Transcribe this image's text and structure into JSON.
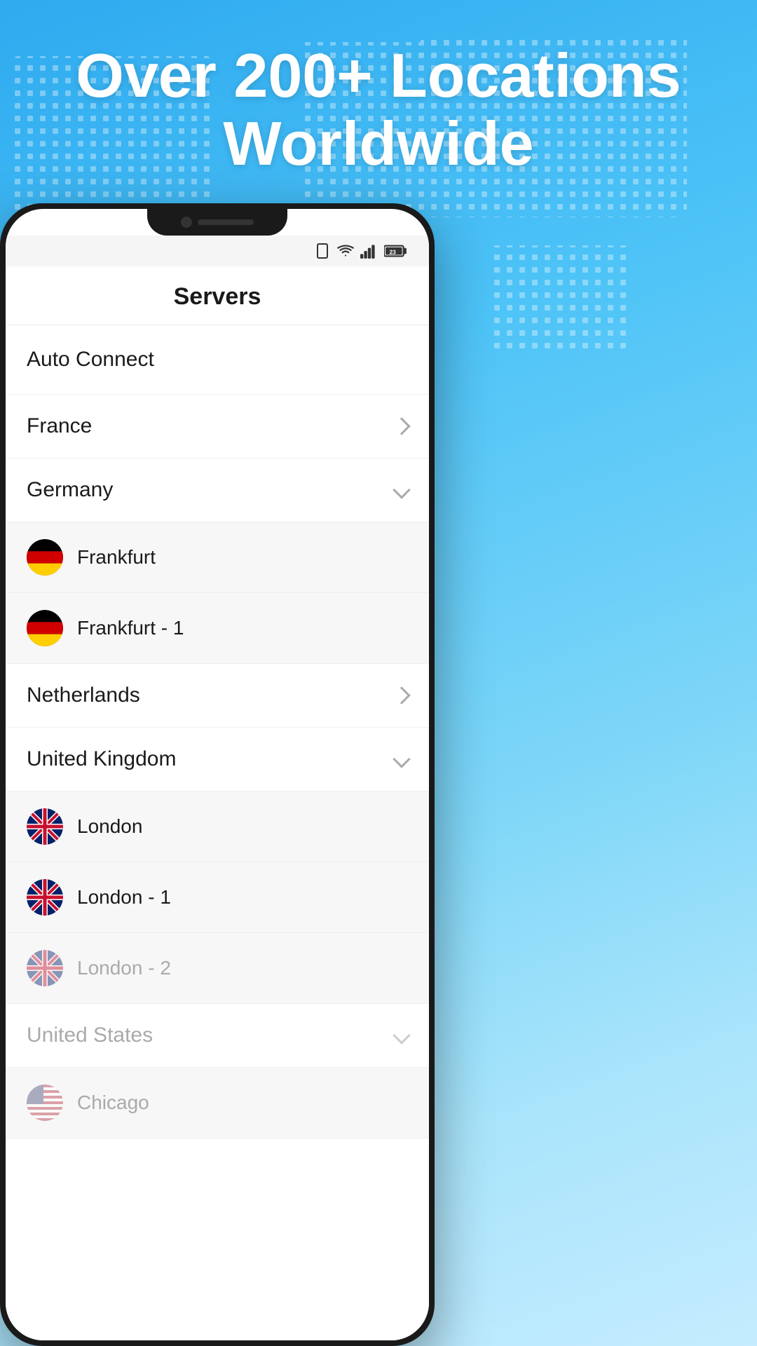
{
  "header": {
    "title": "Over 200+ Locations Worldwide"
  },
  "phone": {
    "status_bar": {
      "icons": [
        "📱",
        "wifi",
        "signal",
        "23"
      ]
    },
    "screen": {
      "nav_title": "Servers",
      "auto_connect_label": "Auto Connect",
      "countries": [
        {
          "name": "France",
          "expanded": false,
          "cities": []
        },
        {
          "name": "Germany",
          "expanded": true,
          "cities": [
            {
              "name": "Frankfurt",
              "flag": "de"
            },
            {
              "name": "Frankfurt - 1",
              "flag": "de"
            }
          ]
        },
        {
          "name": "Netherlands",
          "expanded": false,
          "cities": []
        },
        {
          "name": "United Kingdom",
          "expanded": true,
          "cities": [
            {
              "name": "London",
              "flag": "gb",
              "faded": false
            },
            {
              "name": "London - 1",
              "flag": "gb",
              "faded": false
            },
            {
              "name": "London - 2",
              "flag": "gb",
              "faded": true
            }
          ]
        },
        {
          "name": "United States",
          "expanded": true,
          "faded": true,
          "cities": [
            {
              "name": "Chicago",
              "flag": "us",
              "faded": true
            }
          ]
        }
      ]
    }
  }
}
